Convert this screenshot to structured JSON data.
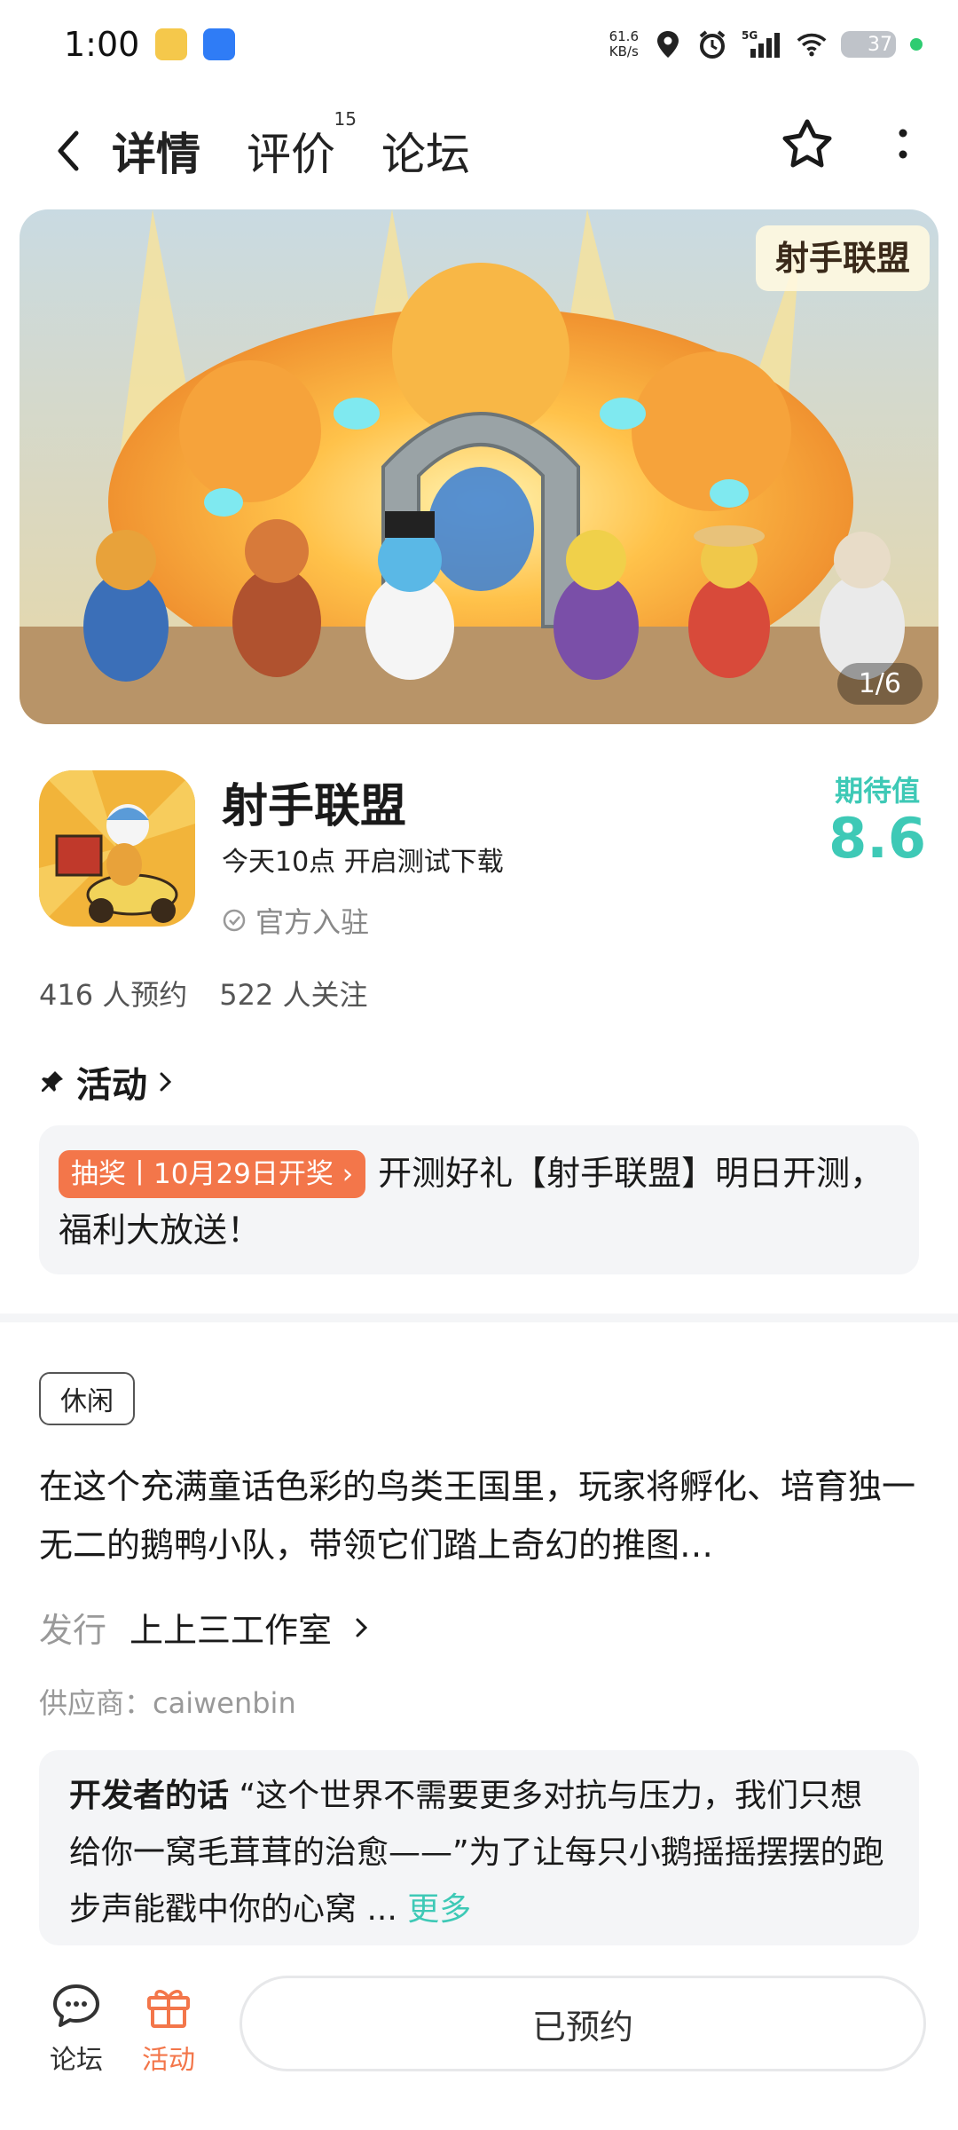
{
  "status_bar": {
    "time": "1:00",
    "net_speed_value": "61.6",
    "net_speed_unit": "KB/s",
    "network": "5G",
    "battery": "37"
  },
  "nav": {
    "tabs": [
      {
        "label": "详情"
      },
      {
        "label": "评价",
        "count": "15"
      },
      {
        "label": "论坛"
      }
    ]
  },
  "banner": {
    "logo_text": "射手联盟",
    "counter": "1/6"
  },
  "app": {
    "name": "射手联盟",
    "subtitle": "今天10点 开启测试下载",
    "official": "官方入驻",
    "expect_label": "期待值",
    "expect_value": "8.6"
  },
  "stats": {
    "reservations": "416 人预约",
    "followers": "522 人关注"
  },
  "activity": {
    "heading": "活动",
    "tag": "抽奖丨10月29日开奖",
    "text": "开测好礼【射手联盟】明日开测，福利大放送！"
  },
  "details": {
    "chip": "休闲",
    "description": "在这个充满童话色彩的鸟类王国里，玩家将孵化、培育独一无二的鹅鸭小队，带领它们踏上奇幻的推图…",
    "publisher_label": "发行",
    "publisher_value": "上上三工作室",
    "supplier": "供应商：caiwenbin"
  },
  "developer": {
    "title": "开发者的话",
    "text": "“这个世界不需要更多对抗与压力，我们只想给你一窝毛茸茸的治愈——”为了让每只小鹅摇摇摆摆的跑步声能戳中你的心窝 ...",
    "more": "更多"
  },
  "bottom_bar": {
    "forum": "论坛",
    "activity": "活动",
    "reserve_button": "已预约"
  },
  "colors": {
    "accent": "#3ec9b6",
    "tag_orange": "#f3764a",
    "card_bg": "#f4f5f7"
  }
}
